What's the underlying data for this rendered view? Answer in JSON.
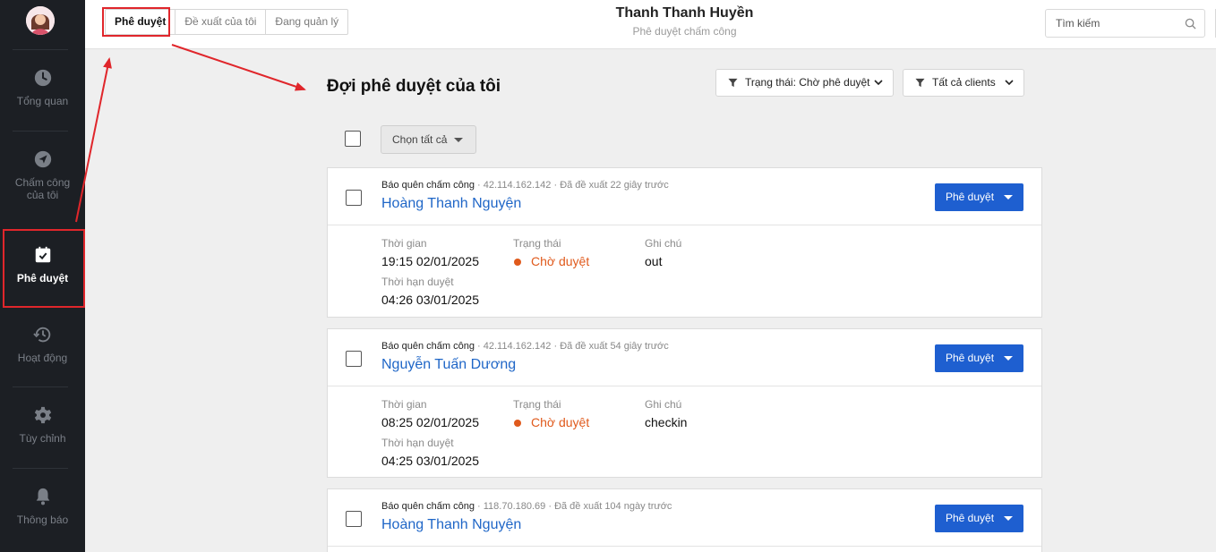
{
  "sidebar": {
    "items": [
      {
        "label": "Tổng quan",
        "icon": "clock-icon"
      },
      {
        "label": "Chấm công của tôi",
        "icon": "send-icon"
      },
      {
        "label": "Phê duyệt",
        "icon": "calendar-check-icon"
      },
      {
        "label": "Hoạt động",
        "icon": "history-icon"
      },
      {
        "label": "Tùy chỉnh",
        "icon": "gear-icon"
      },
      {
        "label": "Thông báo",
        "icon": "bell-icon"
      }
    ],
    "active_index": 2
  },
  "header": {
    "tabs": [
      "Phê duyệt",
      "Đề xuất của tôi",
      "Đang quản lý"
    ],
    "user_name": "Thanh Thanh Huyền",
    "subtitle": "Phê duyệt chấm công",
    "search_placeholder": "Tìm kiếm"
  },
  "main": {
    "title": "Đợi phê duyệt của tôi",
    "filter_status": "Trạng thái: Chờ phê duyệt",
    "filter_clients": "Tất cả clients",
    "select_all": "Chọn tất cả",
    "field_labels": {
      "time": "Thời gian",
      "status": "Trạng thái",
      "note": "Ghi chú",
      "deadline": "Thời hạn duyệt"
    },
    "approve_label": "Phê duyệt",
    "requests": [
      {
        "kind": "Báo quên chấm công",
        "ip": "42.114.162.142",
        "ago": "Đã đề xuất 22 giây trước",
        "name": "Hoàng Thanh Nguyện",
        "time": "19:15 02/01/2025",
        "status": "Chờ duyệt",
        "note": "out",
        "deadline": "04:26 03/01/2025"
      },
      {
        "kind": "Báo quên chấm công",
        "ip": "42.114.162.142",
        "ago": "Đã đề xuất 54 giây trước",
        "name": "Nguyễn Tuấn Dương",
        "time": "08:25 02/01/2025",
        "status": "Chờ duyệt",
        "note": "checkin",
        "deadline": "04:25 03/01/2025"
      },
      {
        "kind": "Báo quên chấm công",
        "ip": "118.70.180.69",
        "ago": "Đã đề xuất 104 ngày trước",
        "name": "Hoàng Thanh Nguyện"
      }
    ]
  },
  "colors": {
    "sidebar_bg": "#1c1f24",
    "accent_blue": "#1e5fd0",
    "status_orange": "#e05a1c",
    "annotation_red": "#e0262b"
  }
}
